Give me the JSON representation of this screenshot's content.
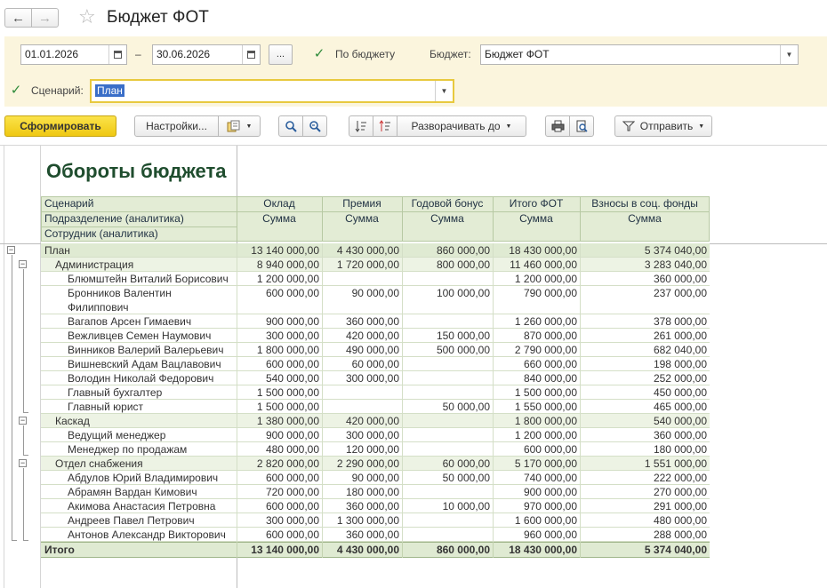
{
  "window": {
    "title": "Бюджет ФОТ",
    "back_icon": "←",
    "forward_icon": "→",
    "star_icon": "☆"
  },
  "params": {
    "date_from": "01.01.2026",
    "date_sep": "–",
    "date_to": "30.06.2026",
    "dots_label": "...",
    "by_budget_checked": true,
    "by_budget_label": "По бюджету",
    "budget_label": "Бюджет:",
    "budget_value": "Бюджет ФОТ",
    "scenario_checked": true,
    "scenario_label": "Сценарий:",
    "scenario_value": "План"
  },
  "toolbar": {
    "generate": "Сформировать",
    "settings": "Настройки...",
    "expand_to": "Разворачивать до",
    "send": "Отправить"
  },
  "report": {
    "title": "Обороты бюджета",
    "row_headers": [
      "Сценарий",
      "Подразделение (аналитика)",
      "Сотрудник (аналитика)"
    ],
    "columns": [
      {
        "name": "Оклад",
        "sub": "Сумма"
      },
      {
        "name": "Премия",
        "sub": "Сумма"
      },
      {
        "name": "Годовой бонус",
        "sub": "Сумма"
      },
      {
        "name": "Итого ФОТ",
        "sub": "Сумма"
      },
      {
        "name": "Взносы в соц. фонды",
        "sub": "Сумма"
      }
    ],
    "rows": [
      {
        "label": "План",
        "level": 0,
        "values": [
          "13 140 000,00",
          "4 430 000,00",
          "860 000,00",
          "18 430 000,00",
          "5 374 040,00"
        ]
      },
      {
        "label": "Администрация",
        "level": 1,
        "values": [
          "8 940 000,00",
          "1 720 000,00",
          "800 000,00",
          "11 460 000,00",
          "3 283 040,00"
        ]
      },
      {
        "label": "Блюмштейн Виталий Борисович",
        "level": 2,
        "values": [
          "1 200 000,00",
          "",
          "",
          "1 200 000,00",
          "360 000,00"
        ]
      },
      {
        "label": "Бронников Валентин",
        "label2": "Филиппович",
        "level": 2,
        "values": [
          "600 000,00",
          "90 000,00",
          "100 000,00",
          "790 000,00",
          "237 000,00"
        ]
      },
      {
        "label": "Вагапов Арсен Гимаевич",
        "level": 2,
        "values": [
          "900 000,00",
          "360 000,00",
          "",
          "1 260 000,00",
          "378 000,00"
        ]
      },
      {
        "label": "Вежливцев Семен Наумович",
        "level": 2,
        "values": [
          "300 000,00",
          "420 000,00",
          "150 000,00",
          "870 000,00",
          "261 000,00"
        ]
      },
      {
        "label": "Винников Валерий Валерьевич",
        "level": 2,
        "values": [
          "1 800 000,00",
          "490 000,00",
          "500 000,00",
          "2 790 000,00",
          "682 040,00"
        ]
      },
      {
        "label": "Вишневский Адам Вацлавович",
        "level": 2,
        "values": [
          "600 000,00",
          "60 000,00",
          "",
          "660 000,00",
          "198 000,00"
        ]
      },
      {
        "label": "Володин Николай Федорович",
        "level": 2,
        "values": [
          "540 000,00",
          "300 000,00",
          "",
          "840 000,00",
          "252 000,00"
        ]
      },
      {
        "label": "Главный бухгалтер",
        "level": 2,
        "values": [
          "1 500 000,00",
          "",
          "",
          "1 500 000,00",
          "450 000,00"
        ]
      },
      {
        "label": "Главный юрист",
        "level": 2,
        "values": [
          "1 500 000,00",
          "",
          "50 000,00",
          "1 550 000,00",
          "465 000,00"
        ]
      },
      {
        "label": "Каскад",
        "level": 1,
        "values": [
          "1 380 000,00",
          "420 000,00",
          "",
          "1 800 000,00",
          "540 000,00"
        ]
      },
      {
        "label": "Ведущий менеджер",
        "level": 2,
        "values": [
          "900 000,00",
          "300 000,00",
          "",
          "1 200 000,00",
          "360 000,00"
        ]
      },
      {
        "label": "Менеджер по продажам",
        "level": 2,
        "values": [
          "480 000,00",
          "120 000,00",
          "",
          "600 000,00",
          "180 000,00"
        ]
      },
      {
        "label": "Отдел снабжения",
        "level": 1,
        "values": [
          "2 820 000,00",
          "2 290 000,00",
          "60 000,00",
          "5 170 000,00",
          "1 551 000,00"
        ]
      },
      {
        "label": "Абдулов Юрий Владимирович",
        "level": 2,
        "values": [
          "600 000,00",
          "90 000,00",
          "50 000,00",
          "740 000,00",
          "222 000,00"
        ]
      },
      {
        "label": "Абрамян Вардан Кимович",
        "level": 2,
        "values": [
          "720 000,00",
          "180 000,00",
          "",
          "900 000,00",
          "270 000,00"
        ]
      },
      {
        "label": "Акимова Анастасия Петровна",
        "level": 2,
        "values": [
          "600 000,00",
          "360 000,00",
          "10 000,00",
          "970 000,00",
          "291 000,00"
        ]
      },
      {
        "label": "Андреев Павел Петрович",
        "level": 2,
        "values": [
          "300 000,00",
          "1 300 000,00",
          "",
          "1 600 000,00",
          "480 000,00"
        ]
      },
      {
        "label": "Антонов Александр Викторович",
        "level": 2,
        "values": [
          "600 000,00",
          "360 000,00",
          "",
          "960 000,00",
          "288 000,00"
        ]
      }
    ],
    "total": {
      "label": "Итого",
      "values": [
        "13 140 000,00",
        "4 430 000,00",
        "860 000,00",
        "18 430 000,00",
        "5 374 040,00"
      ]
    }
  },
  "colors": {
    "header_bg": "#e3ecd5",
    "level0_bg": "#dfead2",
    "level1_bg": "#edf3e4",
    "total_bg": "#dfead2",
    "title": "#1f4d2e",
    "params_bg": "#fbf5dd",
    "primary_button": "#f5d526"
  }
}
